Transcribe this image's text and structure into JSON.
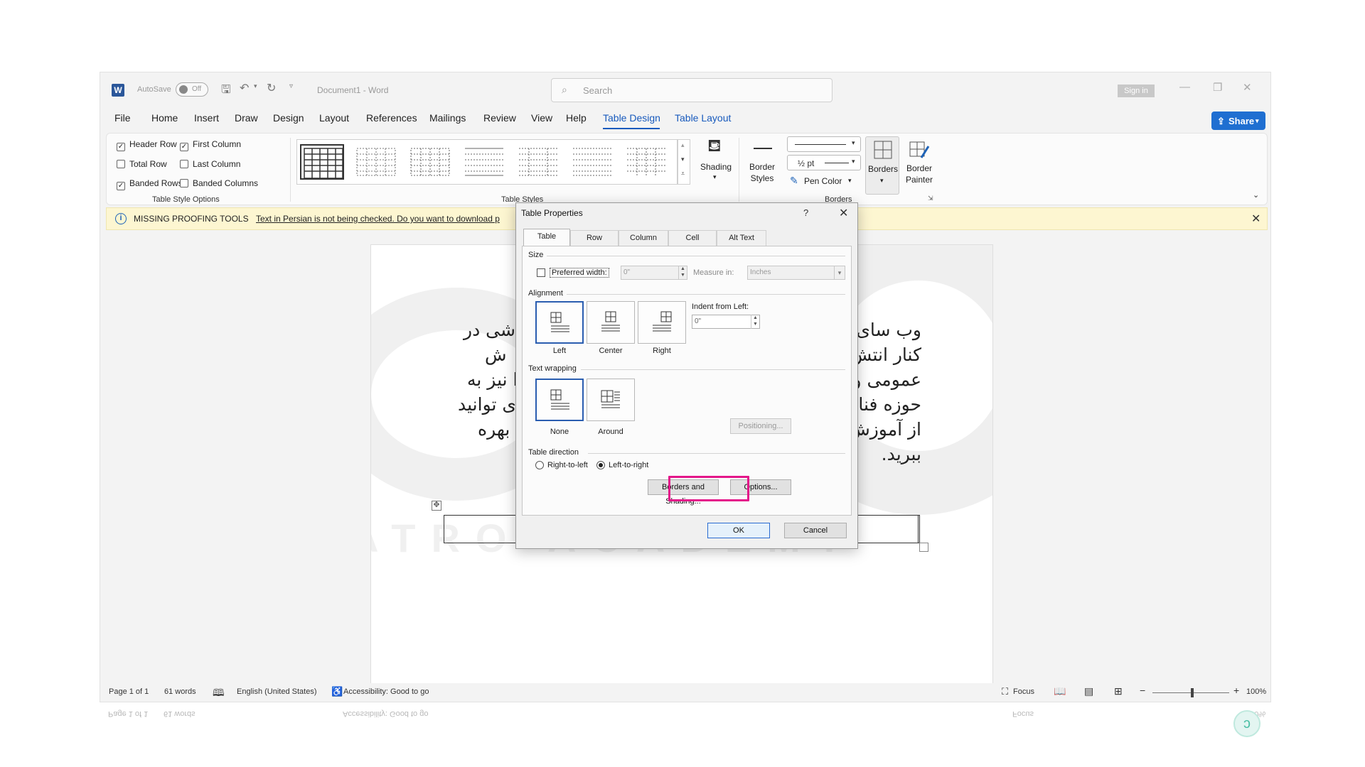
{
  "titlebar": {
    "logo_letter": "W",
    "autosave_label": "AutoSave",
    "autosave_state": "Off",
    "document_title": "Document1  -  Word",
    "search_placeholder": "Search",
    "signin_label": "Sign in"
  },
  "menu": {
    "items": [
      "File",
      "Home",
      "Insert",
      "Draw",
      "Design",
      "Layout",
      "References",
      "Mailings",
      "Review",
      "View",
      "Help",
      "Table Design",
      "Table Layout"
    ],
    "active": "Table Design",
    "share_label": "Share"
  },
  "ribbon": {
    "options": [
      {
        "label": "Header Row",
        "checked": true
      },
      {
        "label": "First Column",
        "checked": true
      },
      {
        "label": "Total Row",
        "checked": false
      },
      {
        "label": "Last Column",
        "checked": false
      },
      {
        "label": "Banded Rows",
        "checked": true
      },
      {
        "label": "Banded Columns",
        "checked": false
      }
    ],
    "options_group_label": "Table Style Options",
    "styles_group_label": "Table Styles",
    "shading_label": "Shading",
    "border_styles_label_1": "Border",
    "border_styles_label_2": "Styles",
    "pen_weight": "½ pt",
    "pen_color_label": "Pen Color",
    "borders_label": "Borders",
    "border_painter_label_1": "Border",
    "border_painter_label_2": "Painter",
    "borders_group_label": "Borders"
  },
  "notification": {
    "title": "MISSING PROOFING TOOLS",
    "message": "Text in Persian is not being checked. Do you want to download p"
  },
  "document": {
    "lines": [
      {
        "left": "شی در",
        "right": "وب سای"
      },
      {
        "left": "ش",
        "right": "کنار انتش"
      },
      {
        "left": "ا نیز به",
        "right": "عمومی و"
      },
      {
        "left": "ی توانید",
        "right": "حوزه فنا"
      },
      {
        "left": "بهره",
        "right": "از آموزش"
      },
      {
        "left": "",
        "right": "ببرید."
      }
    ],
    "watermark": "ATRO ACADEMY"
  },
  "dialog": {
    "title": "Table Properties",
    "help": "?",
    "tabs": [
      "Table",
      "Row",
      "Column",
      "Cell",
      "Alt Text"
    ],
    "size_label": "Size",
    "preferred_width_label": "Preferred width:",
    "preferred_width_value": "0\"",
    "measure_in_label": "Measure in:",
    "measure_in_value": "Inches",
    "alignment_label": "Alignment",
    "align_left": "Left",
    "align_center": "Center",
    "align_right": "Right",
    "indent_label": "Indent from Left:",
    "indent_value": "0\"",
    "wrapping_label": "Text wrapping",
    "wrap_none": "None",
    "wrap_around": "Around",
    "positioning_label": "Positioning...",
    "direction_label": "Table direction",
    "rtl_label": "Right-to-left",
    "ltr_label": "Left-to-right",
    "borders_shading_label": "Borders and Shading...",
    "options_label": "Options...",
    "ok_label": "OK",
    "cancel_label": "Cancel"
  },
  "status": {
    "page": "Page 1 of 1",
    "words": "61 words",
    "language": "English (United States)",
    "accessibility": "Accessibility: Good to go",
    "focus": "Focus",
    "zoom": "100%",
    "zoom_minus": "−",
    "zoom_plus": "+"
  }
}
